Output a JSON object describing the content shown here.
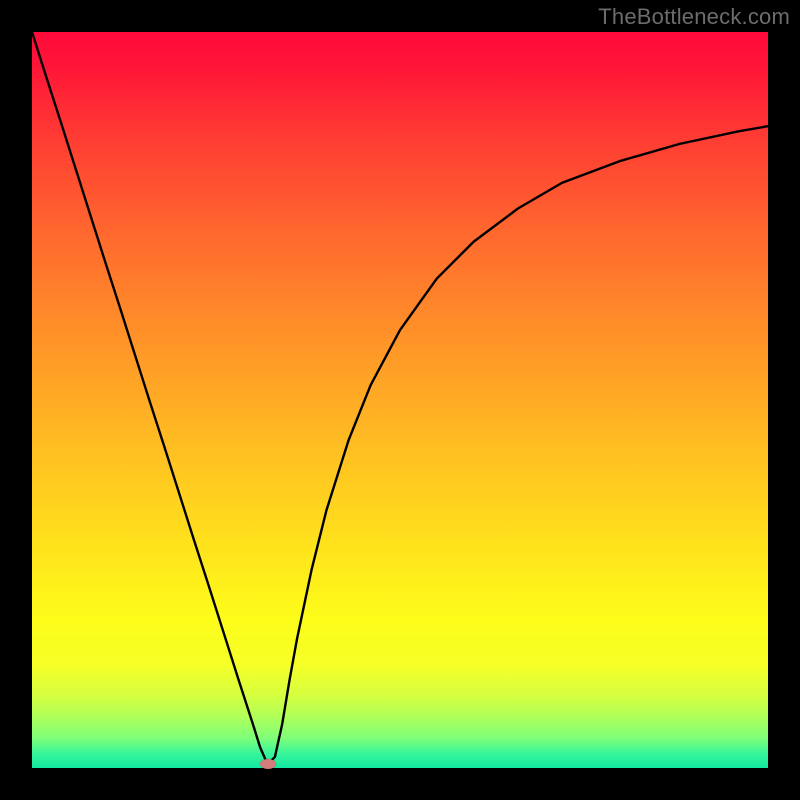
{
  "attribution": "TheBottleneck.com",
  "chart_data": {
    "type": "line",
    "title": "",
    "xlabel": "",
    "ylabel": "",
    "xlim": [
      0,
      100
    ],
    "ylim": [
      0,
      100
    ],
    "series": [
      {
        "name": "bottleneck-curve",
        "x": [
          0,
          2,
          4,
          6,
          8,
          10,
          12,
          14,
          16,
          18,
          20,
          22,
          24,
          26,
          28,
          30,
          31,
          32,
          33,
          34,
          35,
          36,
          38,
          40,
          43,
          46,
          50,
          55,
          60,
          66,
          72,
          80,
          88,
          96,
          100
        ],
        "y": [
          100,
          93.7,
          87.5,
          81.2,
          74.9,
          68.6,
          62.4,
          56.1,
          49.8,
          43.6,
          37.3,
          31.0,
          24.8,
          18.5,
          12.2,
          6.0,
          2.8,
          0.5,
          1.5,
          6.0,
          12.0,
          17.5,
          27.0,
          35.0,
          44.5,
          52.0,
          59.5,
          66.5,
          71.5,
          76.0,
          79.5,
          82.5,
          84.8,
          86.5,
          87.2
        ]
      }
    ],
    "marker": {
      "x": 32,
      "y": 0.5
    },
    "gradient_stops": [
      {
        "pos": 0,
        "color": "#ff0a3a"
      },
      {
        "pos": 0.15,
        "color": "#ff3e33"
      },
      {
        "pos": 0.42,
        "color": "#ff9428"
      },
      {
        "pos": 0.7,
        "color": "#ffe31c"
      },
      {
        "pos": 0.86,
        "color": "#f6ff27"
      },
      {
        "pos": 0.96,
        "color": "#7dff7a"
      },
      {
        "pos": 1.0,
        "color": "#13e9a2"
      }
    ]
  }
}
